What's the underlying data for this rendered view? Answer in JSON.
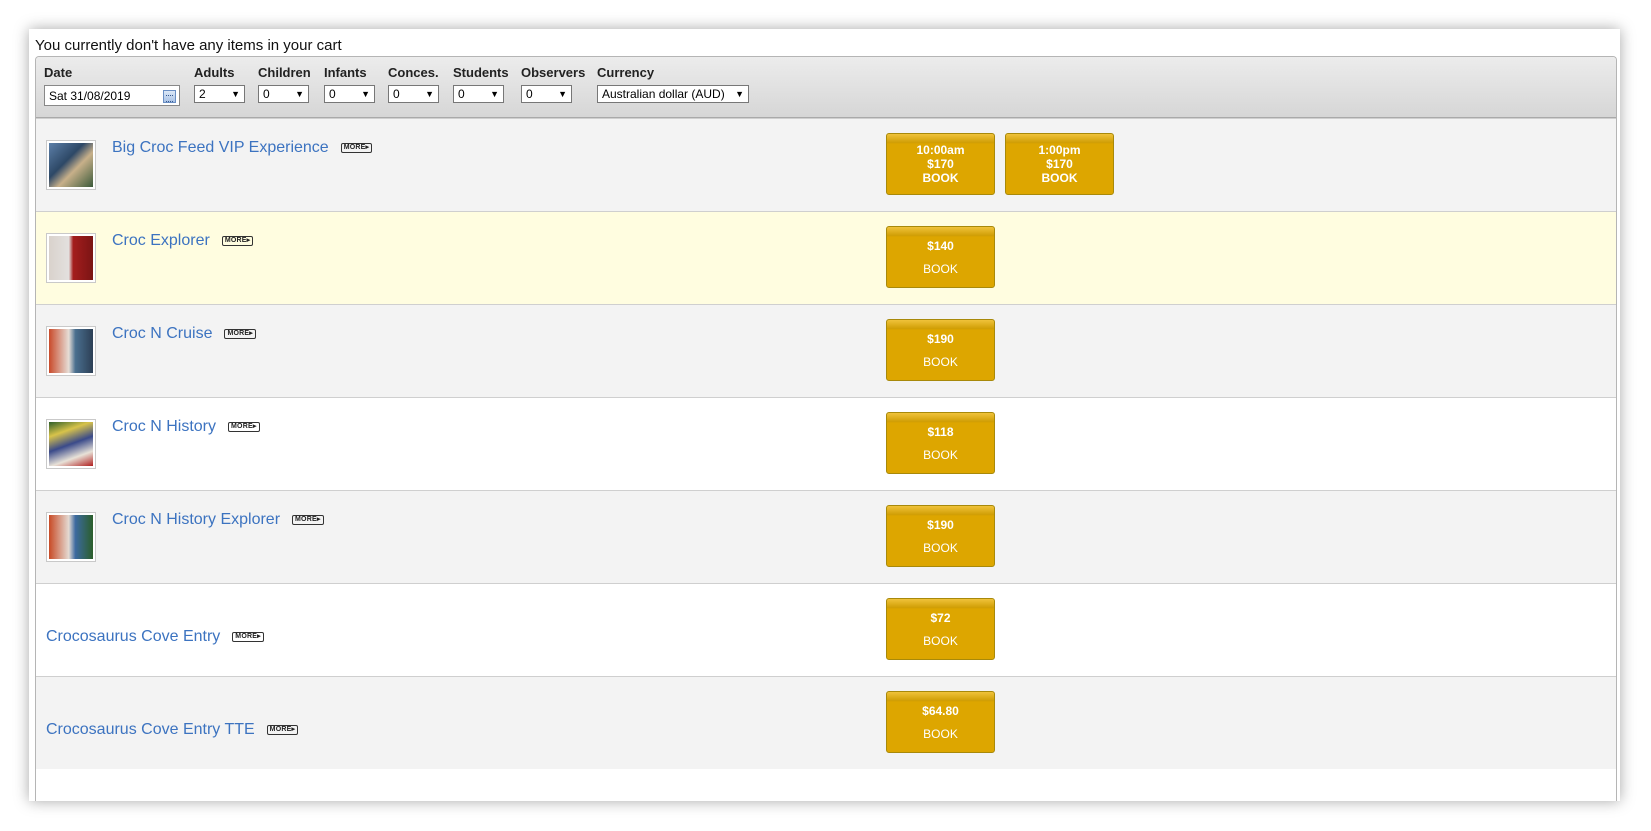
{
  "cart_message": "You currently don't have any items in your cart",
  "filters": {
    "date": {
      "label": "Date",
      "value": "Sat 31/08/2019"
    },
    "adults": {
      "label": "Adults",
      "value": "2"
    },
    "children": {
      "label": "Children",
      "value": "0"
    },
    "infants": {
      "label": "Infants",
      "value": "0"
    },
    "conces": {
      "label": "Conces.",
      "value": "0"
    },
    "students": {
      "label": "Students",
      "value": "0"
    },
    "observers": {
      "label": "Observers",
      "value": "0"
    },
    "currency": {
      "label": "Currency",
      "value": "Australian dollar (AUD)"
    }
  },
  "more_label": "MORE▸",
  "products": [
    {
      "name": "Big Croc Feed VIP Experience",
      "buttons": [
        {
          "time": "10:00am",
          "price": "$170",
          "book": "BOOK"
        },
        {
          "time": "1:00pm",
          "price": "$170",
          "book": "BOOK"
        }
      ]
    },
    {
      "name": "Croc Explorer",
      "buttons": [
        {
          "price": "$140",
          "book": "BOOK"
        }
      ]
    },
    {
      "name": "Croc N Cruise",
      "buttons": [
        {
          "price": "$190",
          "book": "BOOK"
        }
      ]
    },
    {
      "name": "Croc N History",
      "buttons": [
        {
          "price": "$118",
          "book": "BOOK"
        }
      ]
    },
    {
      "name": "Croc N History Explorer",
      "buttons": [
        {
          "price": "$190",
          "book": "BOOK"
        }
      ]
    },
    {
      "name": "Crocosaurus Cove Entry",
      "buttons": [
        {
          "price": "$72",
          "book": "BOOK"
        }
      ]
    },
    {
      "name": "Crocosaurus Cove Entry TTE",
      "buttons": [
        {
          "price": "$64.80",
          "book": "BOOK"
        }
      ]
    }
  ]
}
